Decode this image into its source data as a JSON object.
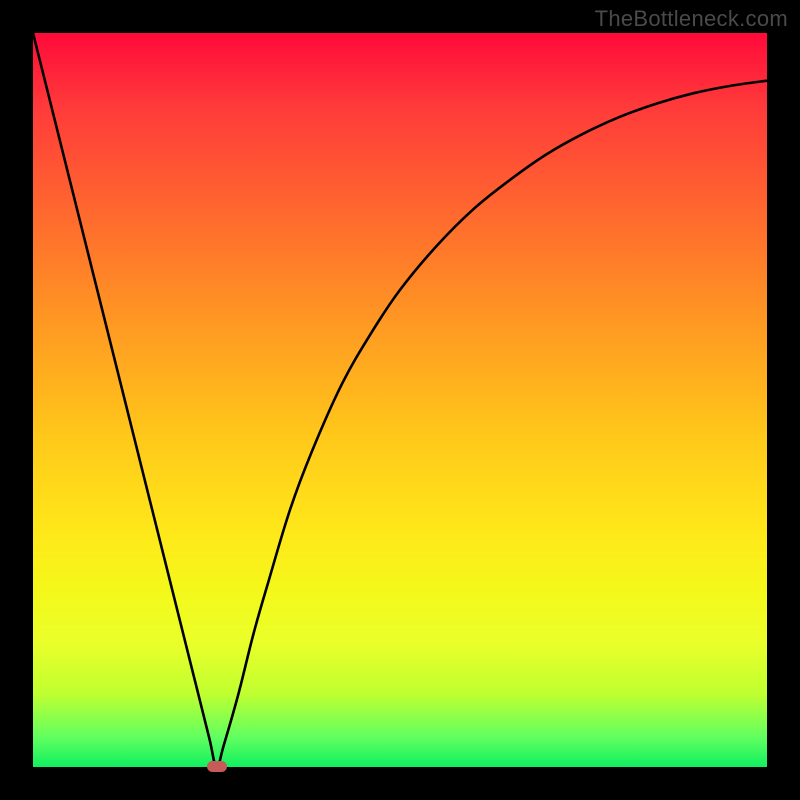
{
  "watermark": "TheBottleneck.com",
  "colors": {
    "curve": "#000000",
    "dot": "#c85a5a",
    "frame": "#000000"
  },
  "chart_data": {
    "type": "line",
    "title": "",
    "xlabel": "",
    "ylabel": "",
    "xlim": [
      0,
      100
    ],
    "ylim": [
      0,
      100
    ],
    "grid": false,
    "series": [
      {
        "name": "bottleneck-curve",
        "x": [
          0,
          2,
          4,
          6,
          8,
          10,
          12,
          14,
          16,
          18,
          20,
          22,
          24,
          25,
          26,
          28,
          30,
          32,
          35,
          38,
          42,
          46,
          50,
          55,
          60,
          65,
          70,
          75,
          80,
          85,
          90,
          95,
          100
        ],
        "y": [
          100,
          92,
          84,
          76,
          68,
          60,
          52,
          44,
          36,
          28,
          20,
          12,
          4,
          0,
          3,
          10,
          18,
          25,
          35,
          43,
          52,
          59,
          65,
          71,
          76,
          80,
          83.5,
          86.3,
          88.6,
          90.4,
          91.8,
          92.8,
          93.5
        ]
      }
    ],
    "marker": {
      "x": 25,
      "y": 0
    },
    "notes": "x/y are percentages of the plot area. Curve descends linearly from top-left to a minimum at x≈25 then rises with diminishing slope toward top-right."
  }
}
